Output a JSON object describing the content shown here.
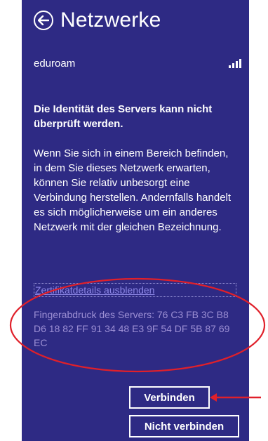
{
  "header": {
    "title": "Netzwerke",
    "back_icon": "back-arrow-circle-icon"
  },
  "network": {
    "name": "eduroam",
    "signal_icon": "signal-bars-icon",
    "signal_level": 4
  },
  "warning": {
    "heading": "Die Identität des Servers kann nicht überprüft werden.",
    "body": "Wenn Sie sich in einem Bereich befinden, in dem Sie dieses Netzwerk erwarten, können Sie relativ unbesorgt eine Verbindung herstellen. Andernfalls handelt es sich möglicherweise um ein anderes Netzwerk mit der gleichen Bezeichnung."
  },
  "certificate": {
    "toggle_label": "Zertifikatdetails ausblenden",
    "fingerprint_text": "Fingerabdruck des Servers: 76 C3 FB 3C B8 D6 18 82 FF 91 34 48 E3 9F 54 DF 5B 87 69 EC"
  },
  "actions": {
    "connect_label": "Verbinden",
    "no_connect_label": "Nicht verbinden"
  },
  "colors": {
    "panel_background": "#2e2a84",
    "annotation_red": "#e0202a",
    "link": "#8c86e6"
  }
}
